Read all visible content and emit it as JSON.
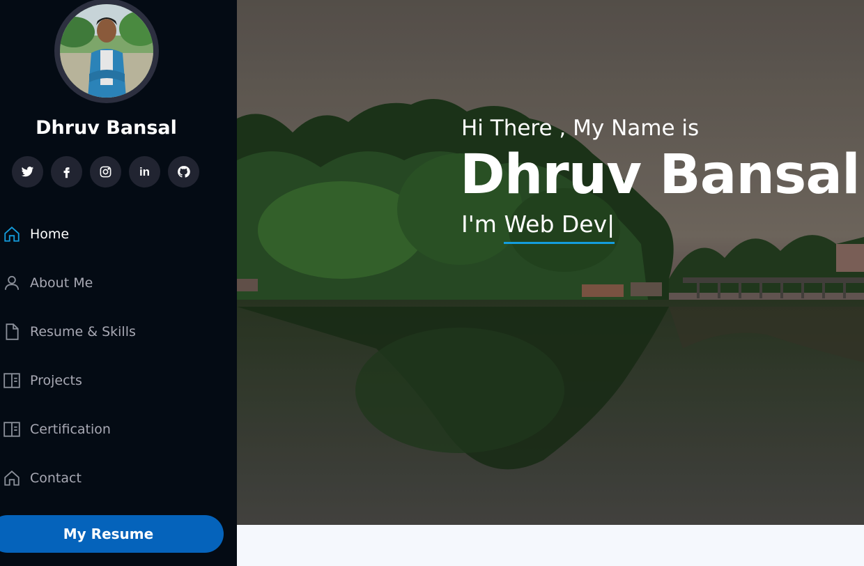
{
  "sidebar": {
    "profile_name": "Dhruv Bansal",
    "socials": [
      {
        "icon": "twitter-icon"
      },
      {
        "icon": "facebook-icon"
      },
      {
        "icon": "instagram-icon"
      },
      {
        "icon": "linkedin-icon",
        "glyph": "in"
      },
      {
        "icon": "github-icon"
      }
    ],
    "nav": [
      {
        "label": "Home",
        "icon": "home-icon",
        "active": true
      },
      {
        "label": "About Me",
        "icon": "person-icon"
      },
      {
        "label": "Resume & Skills",
        "icon": "file-icon"
      },
      {
        "label": "Projects",
        "icon": "book-icon"
      },
      {
        "label": "Certification",
        "icon": "book-icon"
      },
      {
        "label": "Contact",
        "icon": "home-icon"
      }
    ],
    "resume_button": "My Resume"
  },
  "hero": {
    "greeting": "Hi There , My Name is",
    "name": "Dhruv Bansal",
    "role_prefix": "I'm ",
    "role_typed": "Web Dev",
    "cursor": "|"
  },
  "colors": {
    "sidebar_bg": "#040b14",
    "accent": "#149ddd",
    "button": "#0563bb"
  }
}
